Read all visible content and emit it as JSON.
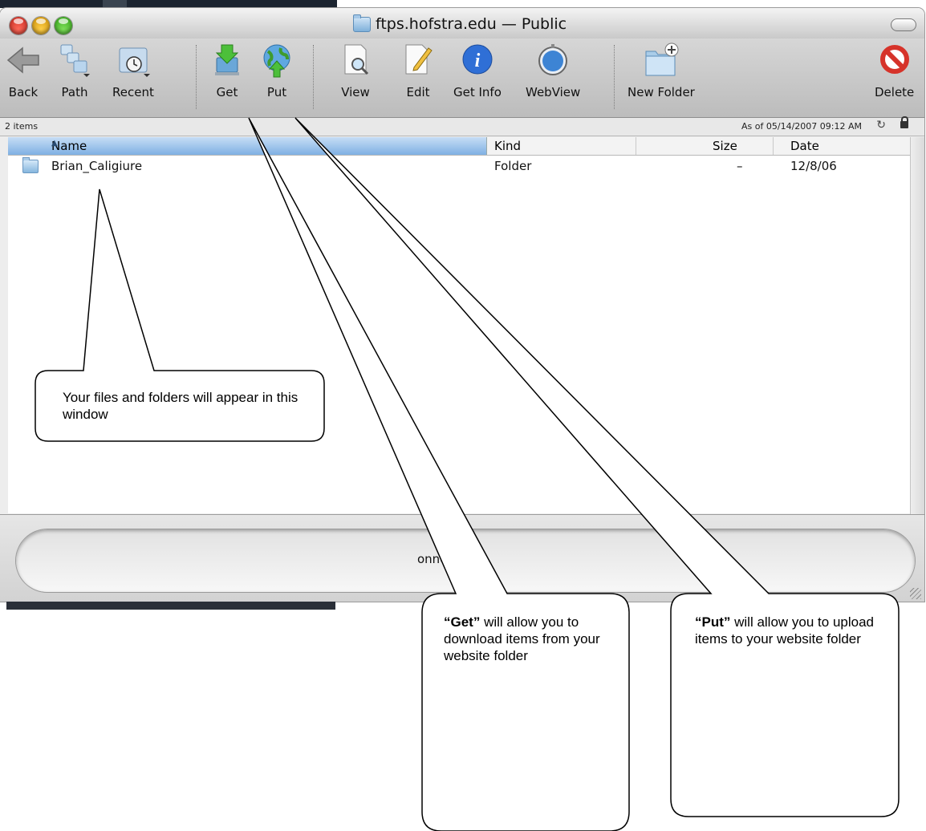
{
  "window": {
    "title": "ftps.hofstra.edu — Public"
  },
  "toolbar": {
    "back": "Back",
    "path": "Path",
    "recent": "Recent",
    "get": "Get",
    "put": "Put",
    "view": "View",
    "edit": "Edit",
    "get_info": "Get Info",
    "webview": "WebView",
    "new_folder": "New Folder",
    "delete": "Delete"
  },
  "status": {
    "item_count": "2 items",
    "as_of": "As of 05/14/2007 09:12 AM"
  },
  "columns": {
    "name": "Name",
    "kind": "Kind",
    "size": "Size",
    "date": "Date"
  },
  "rows": [
    {
      "name": "Brian_Caligiure",
      "kind": "Folder",
      "size": "–",
      "date": "12/8/06"
    }
  ],
  "connection": {
    "text": "onnected."
  },
  "callouts": {
    "window_note": "Your files and folders will appear in this window",
    "get_bold": "“Get”",
    "get_rest": " will allow you to download items from your website folder",
    "put_bold": "“Put”",
    "put_rest": " will allow you to upload items to your website folder"
  },
  "colors": {
    "column_header_selected": "#7fb0e3",
    "toolbar_bg": "#c9c9c9",
    "close_light": "#e0392b",
    "minimize_light": "#f0b400",
    "zoom_light": "#4cc22a"
  }
}
